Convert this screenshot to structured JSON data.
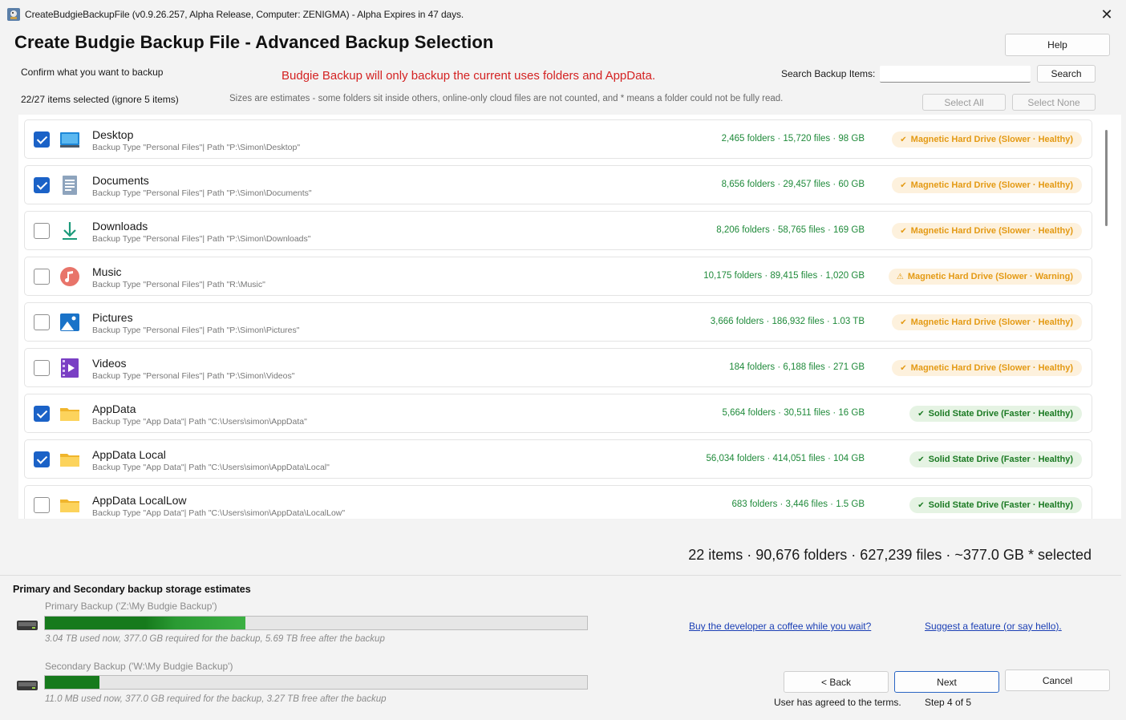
{
  "window": {
    "title": "CreateBudgieBackupFile (v0.9.26.257, Alpha Release, Computer: ZENIGMA) - Alpha Expires in 47 days.",
    "close_label": "✕"
  },
  "header": {
    "title": "Create Budgie Backup File  - Advanced Backup Selection",
    "help_label": "Help",
    "confirm_label": "Confirm what you want to backup",
    "warning": "Budgie Backup will only backup the current uses folders and AppData.",
    "search_label": "Search Backup Items:",
    "search_value": "",
    "search_button": "Search",
    "selected_count": "22/27 items selected (ignore 5 items)",
    "size_note": "Sizes are estimates - some folders sit inside others, online-only cloud files are not counted, and * means a folder could not be fully read.",
    "select_all": "Select All",
    "select_none": "Select None"
  },
  "items": [
    {
      "name": "Desktop",
      "subtitle": "Backup Type \"Personal Files\"| Path \"P:\\Simon\\Desktop\"",
      "stats": "2,465 folders · 15,720 files · 98 GB",
      "badge": "Magnetic Hard Drive (Slower · Healthy)",
      "badge_kind": "hdd",
      "badge_mark": "✔",
      "checked": true,
      "icon": "desktop-icon"
    },
    {
      "name": "Documents",
      "subtitle": "Backup Type \"Personal Files\"| Path \"P:\\Simon\\Documents\"",
      "stats": "8,656 folders · 29,457 files · 60 GB",
      "badge": "Magnetic Hard Drive (Slower · Healthy)",
      "badge_kind": "hdd",
      "badge_mark": "✔",
      "checked": true,
      "icon": "documents-icon"
    },
    {
      "name": "Downloads",
      "subtitle": "Backup Type \"Personal Files\"| Path \"P:\\Simon\\Downloads\"",
      "stats": "8,206 folders · 58,765 files · 169 GB",
      "badge": "Magnetic Hard Drive (Slower · Healthy)",
      "badge_kind": "hdd",
      "badge_mark": "✔",
      "checked": false,
      "icon": "download-icon"
    },
    {
      "name": "Music",
      "subtitle": "Backup Type \"Personal Files\"| Path \"R:\\Music\"",
      "stats": "10,175 folders · 89,415 files · 1,020 GB",
      "badge": "Magnetic Hard Drive (Slower · Warning)",
      "badge_kind": "hdd",
      "badge_mark": "⚠",
      "checked": false,
      "icon": "music-icon"
    },
    {
      "name": "Pictures",
      "subtitle": "Backup Type \"Personal Files\"| Path \"P:\\Simon\\Pictures\"",
      "stats": "3,666 folders · 186,932 files · 1.03 TB",
      "badge": "Magnetic Hard Drive (Slower · Healthy)",
      "badge_kind": "hdd",
      "badge_mark": "✔",
      "checked": false,
      "icon": "pictures-icon"
    },
    {
      "name": "Videos",
      "subtitle": "Backup Type \"Personal Files\"| Path \"P:\\Simon\\Videos\"",
      "stats": "184 folders · 6,188 files · 271 GB",
      "badge": "Magnetic Hard Drive (Slower · Healthy)",
      "badge_kind": "hdd",
      "badge_mark": "✔",
      "checked": false,
      "icon": "videos-icon"
    },
    {
      "name": "AppData",
      "subtitle": "Backup Type \"App Data\"| Path \"C:\\Users\\simon\\AppData\"",
      "stats": "5,664 folders · 30,511 files · 16 GB",
      "badge": "Solid State Drive (Faster · Healthy)",
      "badge_kind": "ssd",
      "badge_mark": "✔",
      "checked": true,
      "icon": "folder-icon"
    },
    {
      "name": "AppData Local",
      "subtitle": "Backup Type \"App Data\"| Path \"C:\\Users\\simon\\AppData\\Local\"",
      "stats": "56,034 folders · 414,051 files · 104 GB",
      "badge": "Solid State Drive (Faster · Healthy)",
      "badge_kind": "ssd",
      "badge_mark": "✔",
      "checked": true,
      "icon": "folder-icon"
    },
    {
      "name": "AppData LocalLow",
      "subtitle": "Backup Type \"App Data\"| Path \"C:\\Users\\simon\\AppData\\LocalLow\"",
      "stats": "683 folders · 3,446 files · 1.5 GB",
      "badge": "Solid State Drive (Faster · Healthy)",
      "badge_kind": "ssd",
      "badge_mark": "✔",
      "checked": false,
      "icon": "folder-icon"
    }
  ],
  "summary": "22 items · 90,676 folders · 627,239 files · ~377.0 GB * selected",
  "storage": {
    "title": "Primary and Secondary backup storage estimates",
    "primary": {
      "label": "Primary Backup ('Z:\\My Budgie Backup')",
      "detail": "3.04 TB used now, 377.0 GB required for the backup, 5.69 TB free after the backup",
      "used_fraction": 0.37
    },
    "secondary": {
      "label": "Secondary Backup ('W:\\My Budgie Backup')",
      "detail": "11.0 MB used now, 377.0 GB required for the backup, 3.27 TB free after the backup",
      "used_fraction": 0.1
    }
  },
  "links": {
    "coffee": "Buy the developer a coffee while you wait?",
    "suggest": "Suggest a feature (or say hello)."
  },
  "footer": {
    "back": "< Back",
    "next": "Next",
    "cancel": "Cancel",
    "terms": "User has agreed to the terms.",
    "step": "Step 4 of 5"
  },
  "colors": {
    "accent": "#1b62c7",
    "stats_green": "#1f8a3a",
    "warning_red": "#d42222",
    "hdd_badge_text": "#e49a14",
    "ssd_badge_text": "#1b7a23",
    "bar_green": "#1f8a26"
  }
}
